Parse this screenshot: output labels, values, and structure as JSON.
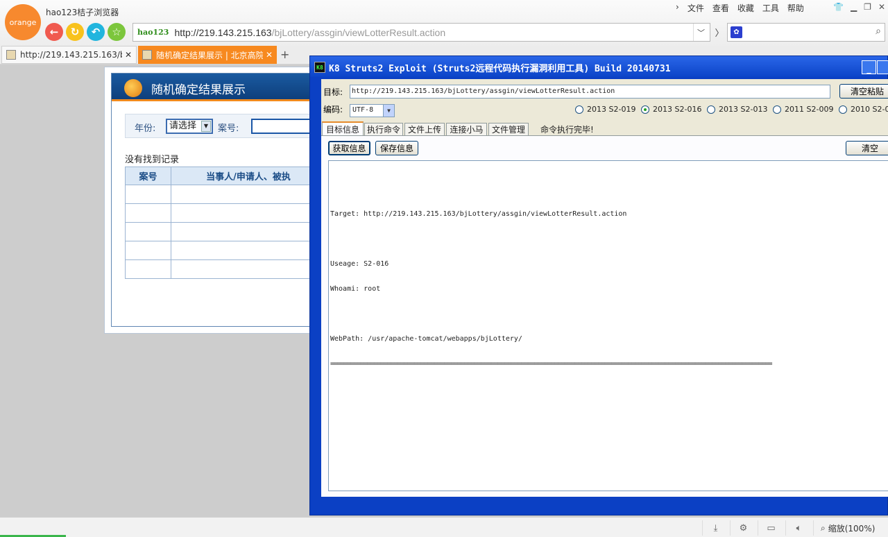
{
  "browser": {
    "logo_text": "orange",
    "app_title": "hao123桔子浏览器",
    "menu": [
      "文件",
      "查看",
      "收藏",
      "工具",
      "帮助"
    ],
    "address": {
      "badge": "hao123",
      "host": "http://219.143.215.163",
      "path": "/bjLottery/assgin/viewLotterResult.action"
    },
    "search_engine_icon": "paw-icon",
    "tabs": [
      {
        "label": "http://219.143.215.163/bj",
        "active": false
      },
      {
        "label": "随机确定结果展示 | 北京高院",
        "active": true
      }
    ],
    "zoom_label": "缩放(100%)",
    "accent_color": "#f7891f"
  },
  "page": {
    "title": "随机确定结果展示",
    "year_label": "年份:",
    "year_select_value": "请选择",
    "case_label": "案号:",
    "no_record": "没有找到记录",
    "table_headers": [
      "案号",
      "当事人/申请人、被执"
    ]
  },
  "k8": {
    "title": "K8 Struts2 Exploit (Struts2远程代码执行漏洞利用工具)  Build 20140731",
    "icon_text": "K8",
    "target_label": "目标:",
    "target_value": "http://219.143.215.163/bjLottery/assgin/viewLotterResult.action",
    "clear_paste_label": "清空粘贴",
    "encoding_label": "编码:",
    "encoding_value": "UTF-8",
    "radios": [
      {
        "label": "2013 S2-019",
        "checked": false
      },
      {
        "label": "2013 S2-016",
        "checked": true
      },
      {
        "label": "2013 S2-013",
        "checked": false
      },
      {
        "label": "2011 S2-009",
        "checked": false
      },
      {
        "label": "2010 S2-0",
        "checked": false
      }
    ],
    "tabs": [
      "目标信息",
      "执行命令",
      "文件上传",
      "连接小马",
      "文件管理"
    ],
    "status": "命令执行完毕!",
    "get_info_label": "获取信息",
    "save_info_label": "保存信息",
    "clear_label": "清空",
    "output_lines": [
      "",
      "Target: http://219.143.215.163/bjLottery/assgin/viewLotterResult.action",
      "",
      "Useage: S2-016",
      "Whoami: root",
      "",
      "WebPath: /usr/apache-tomcat/webapps/bjLottery/",
      "===================================================================================================================================="
    ]
  }
}
